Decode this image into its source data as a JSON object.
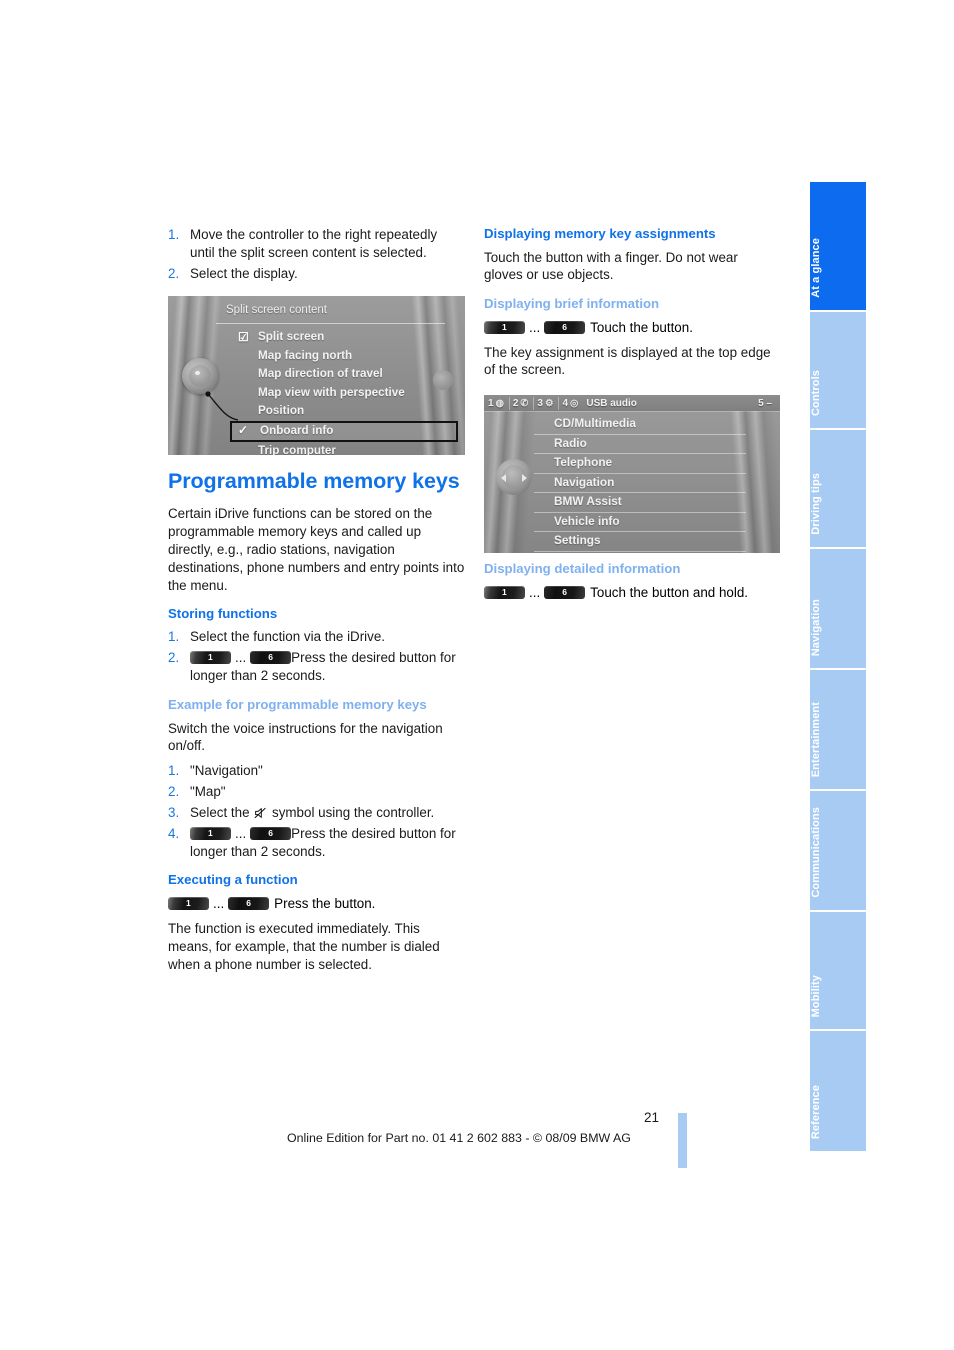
{
  "page": {
    "number": "21",
    "footer": "Online Edition for Part no. 01 41 2 602 883 - © 08/09 BMW AG"
  },
  "left_column": {
    "intro_steps": [
      {
        "num": "1.",
        "text": "Move the controller to the right repeatedly until the split screen content is selected."
      },
      {
        "num": "2.",
        "text": "Select the display."
      }
    ],
    "split_screen_figure": {
      "caption": "Split screen content",
      "items": [
        {
          "label": "Split screen",
          "check": "☑",
          "highlighted": false
        },
        {
          "label": "Map facing north",
          "check": "",
          "highlighted": false
        },
        {
          "label": "Map direction of travel",
          "check": "",
          "highlighted": false
        },
        {
          "label": "Map view with perspective",
          "check": "",
          "highlighted": false
        },
        {
          "label": "Position",
          "check": "",
          "highlighted": false
        },
        {
          "label": "Onboard info",
          "check": "✓",
          "highlighted": true
        },
        {
          "label": "Trip computer",
          "check": "",
          "highlighted": false
        }
      ]
    },
    "title": "Programmable memory keys",
    "intro_paragraph": "Certain iDrive functions can be stored on the programmable memory keys and called up directly, e.g., radio stations, navigation destinations, phone numbers and entry points into the menu.",
    "storing": {
      "heading": "Storing functions",
      "steps": [
        {
          "num": "1.",
          "text": "Select the function via the iDrive."
        },
        {
          "num": "2.",
          "text": "Press the desired button for longer than 2 seconds.",
          "keys": true
        }
      ]
    },
    "example": {
      "heading": "Example for programmable memory keys",
      "intro": "Switch the voice instructions for the navigation on/off.",
      "steps": [
        {
          "num": "1.",
          "text": "\"Navigation\""
        },
        {
          "num": "2.",
          "text": "\"Map\""
        },
        {
          "num": "3.",
          "text": "Select the  symbol using the controller.",
          "icon": "mute-speaker-icon"
        },
        {
          "num": "4.",
          "text": "Press the desired button for longer than 2 seconds.",
          "keys": true
        }
      ]
    },
    "executing": {
      "heading": "Executing a function",
      "key_line": "Press the button.",
      "paragraph": "The function is executed immediately. This means, for example, that the number is dialed when a phone number is selected."
    }
  },
  "right_column": {
    "assignments": {
      "heading": "Displaying memory key assignments",
      "paragraph": "Touch the button with a finger. Do not wear gloves or use objects."
    },
    "brief": {
      "heading": "Displaying brief information",
      "key_line": "Touch the button.",
      "paragraph": "The key assignment is displayed at the top edge of the screen."
    },
    "idrive_figure": {
      "status_slots": [
        {
          "number": "1",
          "icon": "◍"
        },
        {
          "number": "2",
          "icon": "✆"
        },
        {
          "number": "3",
          "icon": "⚙"
        },
        {
          "number": "4",
          "icon": "◎"
        }
      ],
      "status_label": "USB audio",
      "status_right": "5 –",
      "menu_items": [
        "CD/Multimedia",
        "Radio",
        "Telephone",
        "Navigation",
        "BMW Assist",
        "Vehicle info",
        "Settings"
      ]
    },
    "detailed": {
      "heading": "Displaying detailed information",
      "key_line": "Touch the button and hold."
    }
  },
  "keys": {
    "first": "1",
    "last": "6",
    "ellipsis": "..."
  },
  "tabs": [
    {
      "label": "At a glance",
      "active": true
    },
    {
      "label": "Controls",
      "active": false
    },
    {
      "label": "Driving tips",
      "active": false
    },
    {
      "label": "Navigation",
      "active": false
    },
    {
      "label": "Entertainment",
      "active": false
    },
    {
      "label": "Communications",
      "active": false
    },
    {
      "label": "Mobility",
      "active": false
    },
    {
      "label": "Reference",
      "active": false
    }
  ],
  "colors": {
    "accent_blue": "#0d6bf0",
    "light_blue": "#a8cbf4",
    "heading_light": "#7fb0ef"
  }
}
